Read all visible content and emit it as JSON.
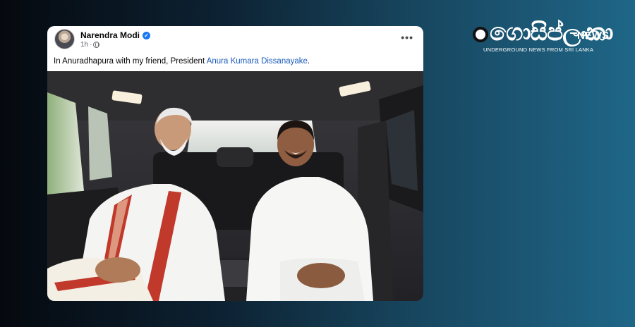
{
  "post": {
    "author": "Narendra Modi",
    "verified_icon": "✓",
    "timestamp": "1h",
    "dot": "·",
    "more_icon": "•••",
    "text_prefix": "In Anuradhapura with my friend, President ",
    "mention": "Anura Kumara Dissanayake",
    "text_suffix": "."
  },
  "logo": {
    "script": "ගොසිප්ලංකා",
    "news": "NEWS",
    "tagline": "UNDERGROUND NEWS FROM SRI LANKA"
  },
  "colors": {
    "facebook_blue": "#1877f2",
    "mention_blue": "#1a5bb8",
    "kurta_white": "#f4f4f2",
    "stole_red": "#c0392b"
  }
}
